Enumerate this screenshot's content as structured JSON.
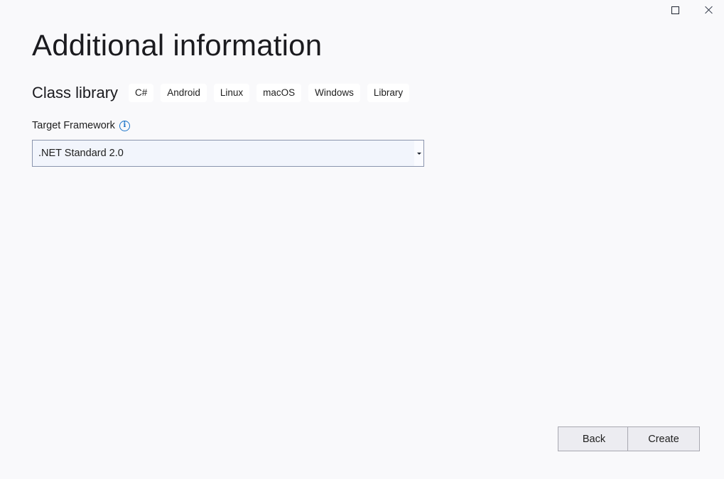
{
  "window": {
    "maximize_icon": "maximize-icon",
    "close_icon": "close-icon"
  },
  "header": {
    "title": "Additional information"
  },
  "project": {
    "name": "Class library",
    "tags": [
      "C#",
      "Android",
      "Linux",
      "macOS",
      "Windows",
      "Library"
    ]
  },
  "form": {
    "target_framework": {
      "label": "Target Framework",
      "info_icon": "info-icon",
      "value": ".NET Standard 2.0"
    }
  },
  "footer": {
    "back_label": "Back",
    "create_label": "Create"
  }
}
